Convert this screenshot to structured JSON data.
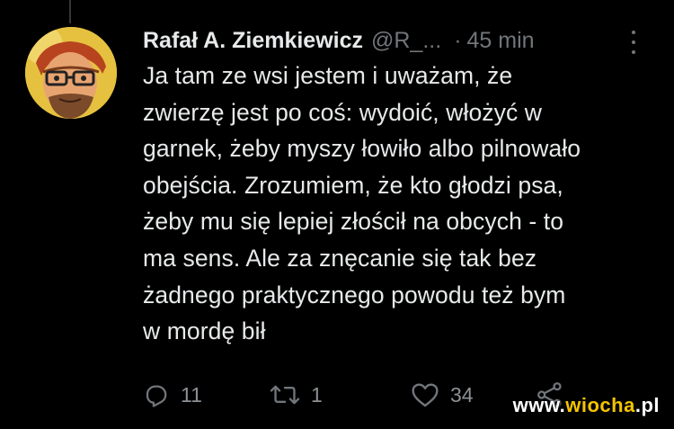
{
  "tweet": {
    "author_name": "Rafał A. Ziemkiewicz",
    "handle": "@R_...",
    "separator": "·",
    "timestamp": "45 min",
    "more_icon": "more-vertical-icon",
    "text_lines": [
      "Ja tam ze wsi jestem i uważam, że",
      "zwierzę jest po coś: wydoić, włożyć w",
      "garnek, żeby myszy łowiło albo pilnowało",
      "obejścia.  Zrozumiem, że kto głodzi psa,",
      "żeby mu się lepiej złościł na obcych - to",
      "ma sens. Ale za znęcanie się tak bez",
      "żadnego praktycznego powodu też bym",
      "w mordę bił"
    ],
    "actions": {
      "reply": {
        "icon": "reply-icon",
        "count": "11"
      },
      "retweet": {
        "icon": "retweet-icon",
        "count": "1"
      },
      "like": {
        "icon": "heart-icon",
        "count": "34"
      },
      "share": {
        "icon": "share-icon"
      }
    }
  },
  "watermark": {
    "prefix": "www.",
    "brand": "wiocha",
    "suffix": ".pl"
  },
  "colors": {
    "background": "#000000",
    "text": "#e7e9ea",
    "secondary": "#71767b",
    "watermark_accent": "#f5c400"
  }
}
